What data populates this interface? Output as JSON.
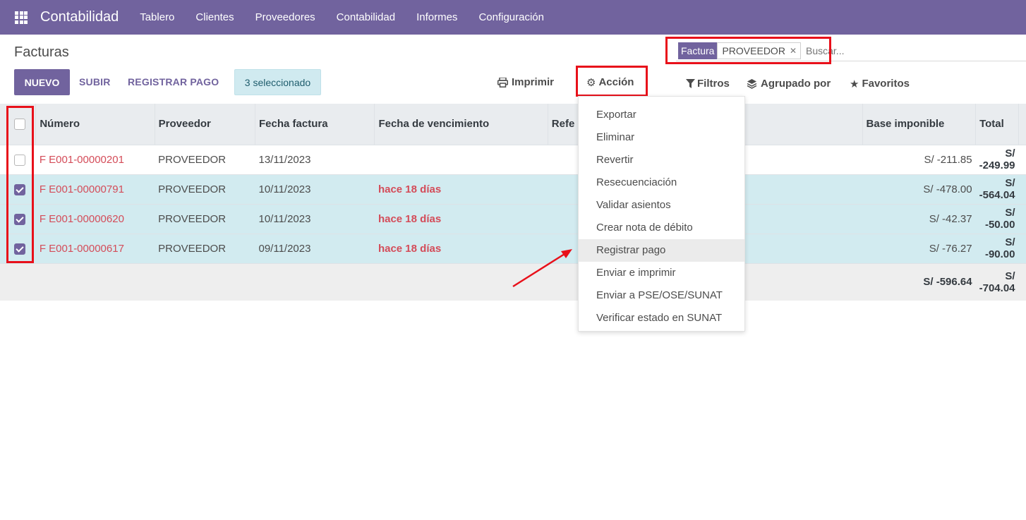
{
  "navbar": {
    "brand": "Contabilidad",
    "menu": [
      "Tablero",
      "Clientes",
      "Proveedores",
      "Contabilidad",
      "Informes",
      "Configuración"
    ]
  },
  "page": {
    "title": "Facturas"
  },
  "toolbar": {
    "new_label": "NUEVO",
    "upload_label": "SUBIR",
    "register_payment_label": "REGISTRAR PAGO",
    "selected_label": "3 seleccionado",
    "print_label": "Imprimir",
    "action_label": "Acción",
    "filters_label": "Filtros",
    "group_by_label": "Agrupado por",
    "favorites_label": "Favoritos"
  },
  "search": {
    "facet_label": "Factura",
    "facet_value": "PROVEEDOR",
    "placeholder": "Buscar..."
  },
  "table": {
    "headers": [
      "Número",
      "Proveedor",
      "Fecha factura",
      "Fecha de vencimiento",
      "Refe",
      "Base imponible",
      "Total"
    ],
    "rows": [
      {
        "numero": "F E001-00000201",
        "proveedor": "PROVEEDOR",
        "fecha": "13/11/2023",
        "vencimiento": "",
        "base": "S/ -211.85",
        "total": "S/ -249.99",
        "selected": false
      },
      {
        "numero": "F E001-00000791",
        "proveedor": "PROVEEDOR",
        "fecha": "10/11/2023",
        "vencimiento": "hace 18 días",
        "base": "S/ -478.00",
        "total": "S/ -564.04",
        "selected": true
      },
      {
        "numero": "F E001-00000620",
        "proveedor": "PROVEEDOR",
        "fecha": "10/11/2023",
        "vencimiento": "hace 18 días",
        "base": "S/ -42.37",
        "total": "S/ -50.00",
        "selected": true
      },
      {
        "numero": "F E001-00000617",
        "proveedor": "PROVEEDOR",
        "fecha": "09/11/2023",
        "vencimiento": "hace 18 días",
        "base": "S/ -76.27",
        "total": "S/ -90.00",
        "selected": true
      }
    ],
    "footer": {
      "base": "S/ -596.64",
      "total": "S/ -704.04"
    }
  },
  "action_menu": {
    "items": [
      "Exportar",
      "Eliminar",
      "Revertir",
      "Resecuenciación",
      "Validar asientos",
      "Crear nota de débito",
      "Registrar pago",
      "Enviar e imprimir",
      "Enviar a PSE/OSE/SUNAT",
      "Verificar estado en SUNAT"
    ],
    "highlighted": "Registrar pago"
  },
  "colors": {
    "brand": "#71639e",
    "annotation": "#e8101a",
    "overdue": "#d44c59",
    "selected_row": "#d2ebf0"
  }
}
